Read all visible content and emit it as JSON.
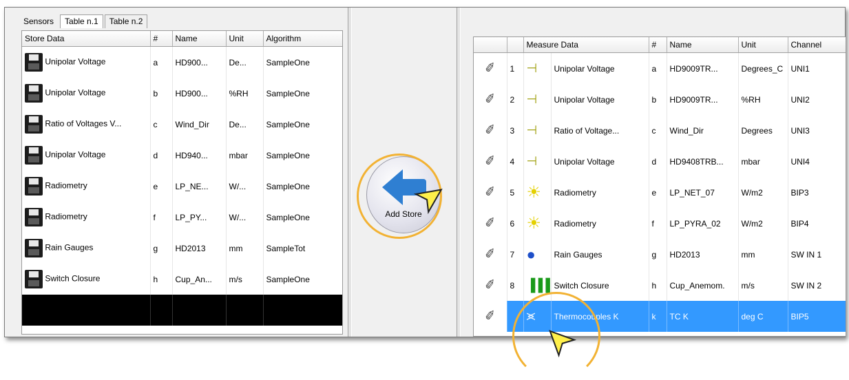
{
  "tabs": [
    "Sensors",
    "Table n.1",
    "Table n.2"
  ],
  "left_table": {
    "headers": [
      "Store Data",
      "#",
      "Name",
      "Unit",
      "Algorithm"
    ],
    "rows": [
      {
        "desc": "Unipolar Voltage",
        "id": "a",
        "name": "HD900...",
        "unit": "De...",
        "algo": "SampleOne"
      },
      {
        "desc": "Unipolar Voltage",
        "id": "b",
        "name": "HD900...",
        "unit": "%RH",
        "algo": "SampleOne"
      },
      {
        "desc": "Ratio of Voltages V...",
        "id": "c",
        "name": "Wind_Dir",
        "unit": "De...",
        "algo": "SampleOne"
      },
      {
        "desc": "Unipolar Voltage",
        "id": "d",
        "name": "HD940...",
        "unit": "mbar",
        "algo": "SampleOne"
      },
      {
        "desc": "Radiometry",
        "id": "e",
        "name": "LP_NE...",
        "unit": "W/...",
        "algo": "SampleOne"
      },
      {
        "desc": "Radiometry",
        "id": "f",
        "name": "LP_PY...",
        "unit": "W/...",
        "algo": "SampleOne"
      },
      {
        "desc": "Rain Gauges",
        "id": "g",
        "name": "HD2013",
        "unit": "mm",
        "algo": "SampleTot"
      },
      {
        "desc": "Switch Closure",
        "id": "h",
        "name": "Cup_An...",
        "unit": "m/s",
        "algo": "SampleOne"
      }
    ]
  },
  "add_store_button": {
    "label": "Add  Store"
  },
  "right_table": {
    "headers": [
      "",
      "",
      "Measure Data",
      "#",
      "Name",
      "Unit",
      "Channel"
    ],
    "rows": [
      {
        "num": "1",
        "icon": "voltage-symbol-icon",
        "desc": "Unipolar Voltage",
        "id": "a",
        "name": "HD9009TR...",
        "unit": "Degrees_C",
        "channel": "UNI1"
      },
      {
        "num": "2",
        "icon": "voltage-symbol-icon",
        "desc": "Unipolar Voltage",
        "id": "b",
        "name": "HD9009TR...",
        "unit": "%RH",
        "channel": "UNI2"
      },
      {
        "num": "3",
        "icon": "voltage-ratio-symbol-icon",
        "desc": "Ratio of Voltage...",
        "id": "c",
        "name": "Wind_Dir",
        "unit": "Degrees",
        "channel": "UNI3"
      },
      {
        "num": "4",
        "icon": "voltage-symbol-icon",
        "desc": "Unipolar Voltage",
        "id": "d",
        "name": "HD9408TRB...",
        "unit": "mbar",
        "channel": "UNI4"
      },
      {
        "num": "5",
        "icon": "lightbulb-icon",
        "desc": "Radiometry",
        "id": "e",
        "name": "LP_NET_07",
        "unit": "W/m2",
        "channel": "BIP3"
      },
      {
        "num": "6",
        "icon": "lightbulb-icon",
        "desc": "Radiometry",
        "id": "f",
        "name": "LP_PYRA_02",
        "unit": "W/m2",
        "channel": "BIP4"
      },
      {
        "num": "7",
        "icon": "raindrop-icon",
        "desc": "Rain Gauges",
        "id": "g",
        "name": "HD2013",
        "unit": "mm",
        "channel": "SW IN 1"
      },
      {
        "num": "8",
        "icon": "pulse-icon",
        "desc": "Switch Closure",
        "id": "h",
        "name": "Cup_Anemom.",
        "unit": "m/s",
        "channel": "SW IN 2"
      },
      {
        "num": "",
        "icon": "thermocouple-icon",
        "desc": "Thermocouples  K",
        "id": "k",
        "name": "TC K",
        "unit": "deg C",
        "channel": "BIP5"
      }
    ]
  }
}
